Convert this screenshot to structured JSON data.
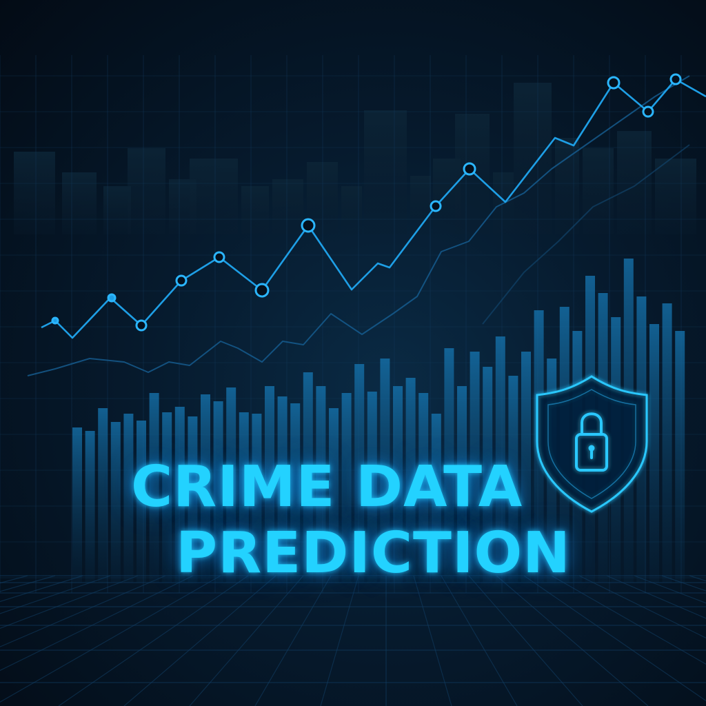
{
  "title": {
    "line1": "CRIME DATA",
    "line2": "PREDICTION"
  },
  "icons": {
    "shield": "shield-icon",
    "lock": "padlock-icon"
  },
  "colors": {
    "background": "#04101d",
    "accent": "#23d2ff",
    "line": "#1e9fe6",
    "bars": "#0f5f8f"
  }
}
